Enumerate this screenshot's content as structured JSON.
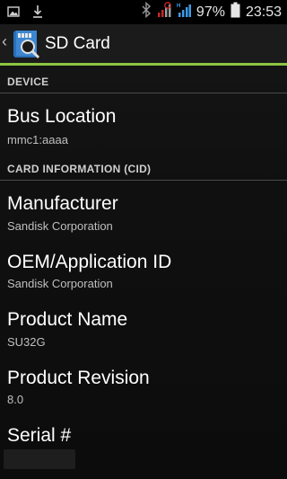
{
  "status_bar": {
    "battery": "97%",
    "time": "23:53",
    "icons": [
      "image-icon",
      "download-icon",
      "bluetooth-icon",
      "signal-icon",
      "data-signal-icon",
      "battery-icon"
    ]
  },
  "action_bar": {
    "title": "SD Card",
    "icon": "sd-card-app-icon",
    "accent_color": "#8bc53f"
  },
  "sections": {
    "device": {
      "header": "DEVICE",
      "items": [
        {
          "title": "Bus Location",
          "summary": "mmc1:aaaa"
        }
      ]
    },
    "card_info": {
      "header": "CARD INFORMATION (CID)",
      "items": [
        {
          "title": "Manufacturer",
          "summary": "Sandisk Corporation"
        },
        {
          "title": "OEM/Application ID",
          "summary": "Sandisk Corporation"
        },
        {
          "title": "Product Name",
          "summary": "SU32G"
        },
        {
          "title": "Product Revision",
          "summary": "8.0"
        },
        {
          "title": "Serial #",
          "summary": ""
        }
      ]
    }
  }
}
